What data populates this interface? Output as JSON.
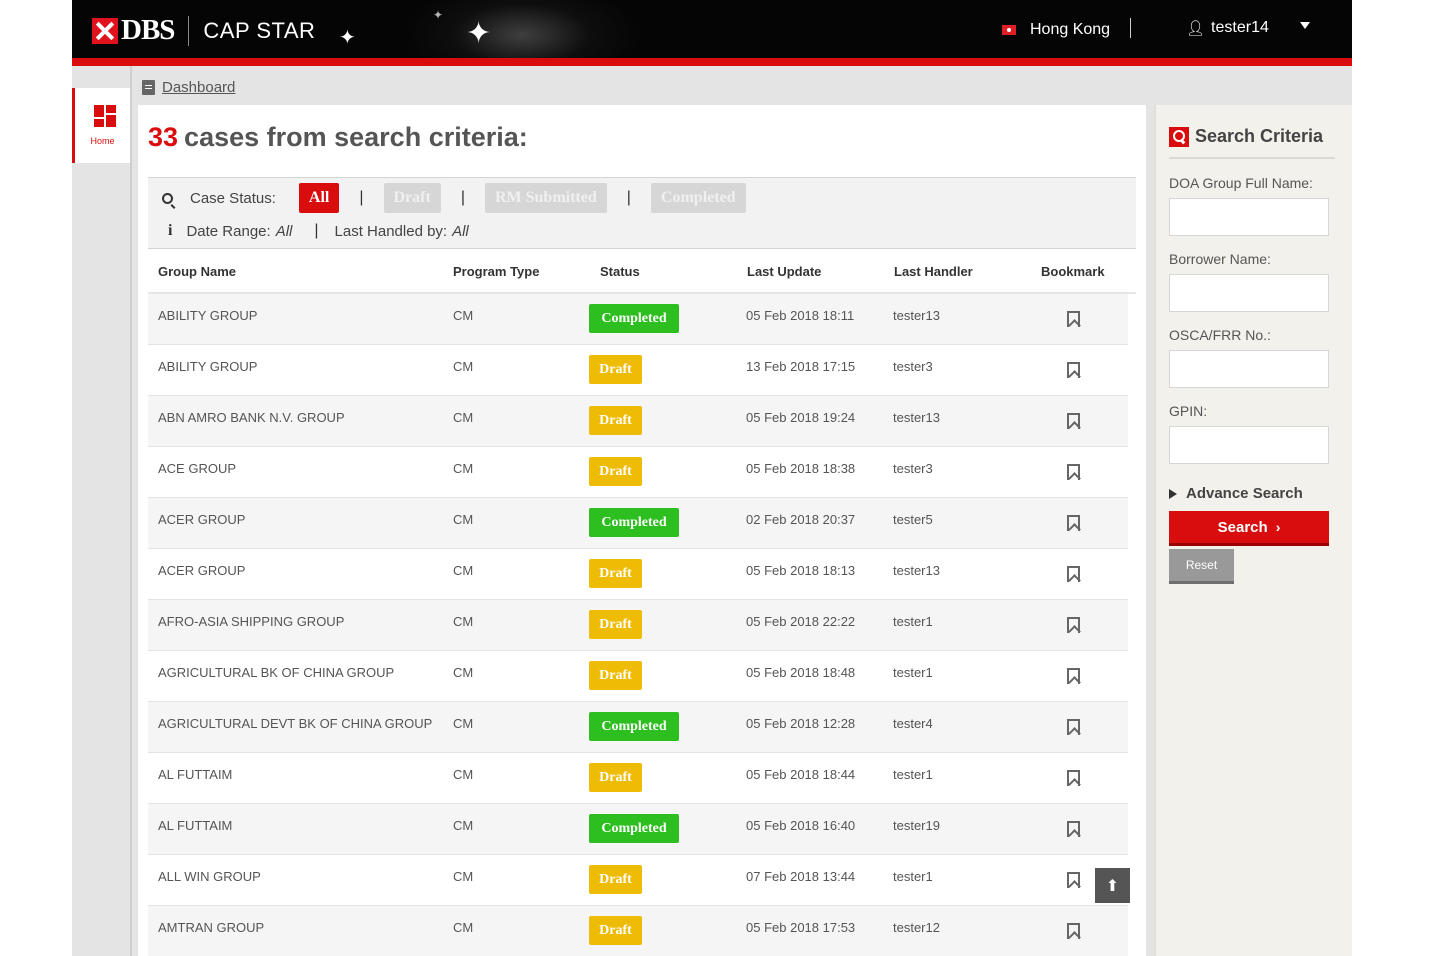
{
  "header": {
    "brand": "DBS",
    "app_name": "CAP STAR",
    "region": "Hong Kong",
    "user": "tester14"
  },
  "sidenav": {
    "home_label": "Home"
  },
  "breadcrumb": {
    "label": "Dashboard"
  },
  "results": {
    "count": "33",
    "text": "cases from search criteria:"
  },
  "filters": {
    "case_status_label": "Case Status:",
    "status_options": [
      "All",
      "Draft",
      "RM Submitted",
      "Completed"
    ],
    "active_status": "All",
    "date_range_label": "Date Range:",
    "date_range_value": "All",
    "last_handled_label": "Last Handled by:",
    "last_handled_value": "All"
  },
  "table": {
    "columns": [
      "Group Name",
      "Program Type",
      "Status",
      "Last Update",
      "Last Handler",
      "Bookmark"
    ],
    "rows": [
      {
        "group": "ABILITY GROUP",
        "program": "CM",
        "status": "Completed",
        "updated": "05 Feb 2018 18:11",
        "handler": "tester13"
      },
      {
        "group": "ABILITY GROUP",
        "program": "CM",
        "status": "Draft",
        "updated": "13 Feb 2018 17:15",
        "handler": "tester3"
      },
      {
        "group": "ABN AMRO BANK N.V. GROUP",
        "program": "CM",
        "status": "Draft",
        "updated": "05 Feb 2018 19:24",
        "handler": "tester13"
      },
      {
        "group": "ACE GROUP",
        "program": "CM",
        "status": "Draft",
        "updated": "05 Feb 2018 18:38",
        "handler": "tester3"
      },
      {
        "group": "ACER GROUP",
        "program": "CM",
        "status": "Completed",
        "updated": "02 Feb 2018 20:37",
        "handler": "tester5"
      },
      {
        "group": "ACER GROUP",
        "program": "CM",
        "status": "Draft",
        "updated": "05 Feb 2018 18:13",
        "handler": "tester13"
      },
      {
        "group": "AFRO-ASIA SHIPPING GROUP",
        "program": "CM",
        "status": "Draft",
        "updated": "05 Feb 2018 22:22",
        "handler": "tester1"
      },
      {
        "group": "AGRICULTURAL BK OF CHINA GROUP",
        "program": "CM",
        "status": "Draft",
        "updated": "05 Feb 2018 18:48",
        "handler": "tester1"
      },
      {
        "group": "AGRICULTURAL DEVT BK OF CHINA GROUP",
        "program": "CM",
        "status": "Completed",
        "updated": "05 Feb 2018 12:28",
        "handler": "tester4"
      },
      {
        "group": "AL FUTTAIM",
        "program": "CM",
        "status": "Draft",
        "updated": "05 Feb 2018 18:44",
        "handler": "tester1"
      },
      {
        "group": "AL FUTTAIM",
        "program": "CM",
        "status": "Completed",
        "updated": "05 Feb 2018 16:40",
        "handler": "tester19"
      },
      {
        "group": "ALL WIN GROUP",
        "program": "CM",
        "status": "Draft",
        "updated": "07 Feb 2018 13:44",
        "handler": "tester1"
      },
      {
        "group": "AMTRAN GROUP",
        "program": "CM",
        "status": "Draft",
        "updated": "05 Feb 2018 17:53",
        "handler": "tester12"
      }
    ]
  },
  "search_panel": {
    "title": "Search Criteria",
    "fields": [
      {
        "label": "DOA Group Full Name:",
        "value": ""
      },
      {
        "label": "Borrower Name:",
        "value": ""
      },
      {
        "label": "OSCA/FRR No.:",
        "value": ""
      },
      {
        "label": "GPIN:",
        "value": ""
      }
    ],
    "advance_label": "Advance Search",
    "search_label": "Search",
    "reset_label": "Reset"
  },
  "colors": {
    "brand_red": "#d90d0d",
    "completed_green": "#2cbf1f",
    "draft_yellow": "#eebb05"
  }
}
